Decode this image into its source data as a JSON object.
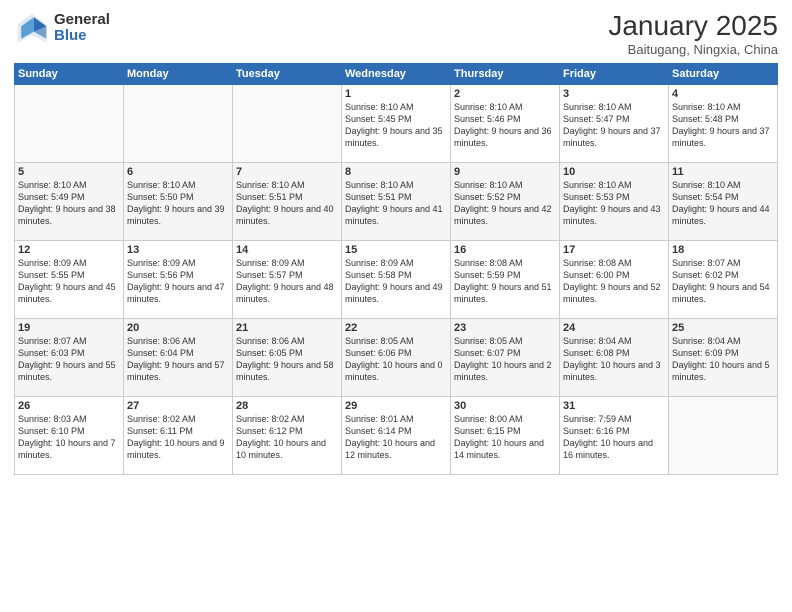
{
  "logo": {
    "general": "General",
    "blue": "Blue"
  },
  "header": {
    "month": "January 2025",
    "location": "Baitugang, Ningxia, China"
  },
  "weekdays": [
    "Sunday",
    "Monday",
    "Tuesday",
    "Wednesday",
    "Thursday",
    "Friday",
    "Saturday"
  ],
  "weeks": [
    [
      {
        "day": "",
        "text": ""
      },
      {
        "day": "",
        "text": ""
      },
      {
        "day": "",
        "text": ""
      },
      {
        "day": "1",
        "text": "Sunrise: 8:10 AM\nSunset: 5:45 PM\nDaylight: 9 hours and 35 minutes."
      },
      {
        "day": "2",
        "text": "Sunrise: 8:10 AM\nSunset: 5:46 PM\nDaylight: 9 hours and 36 minutes."
      },
      {
        "day": "3",
        "text": "Sunrise: 8:10 AM\nSunset: 5:47 PM\nDaylight: 9 hours and 37 minutes."
      },
      {
        "day": "4",
        "text": "Sunrise: 8:10 AM\nSunset: 5:48 PM\nDaylight: 9 hours and 37 minutes."
      }
    ],
    [
      {
        "day": "5",
        "text": "Sunrise: 8:10 AM\nSunset: 5:49 PM\nDaylight: 9 hours and 38 minutes."
      },
      {
        "day": "6",
        "text": "Sunrise: 8:10 AM\nSunset: 5:50 PM\nDaylight: 9 hours and 39 minutes."
      },
      {
        "day": "7",
        "text": "Sunrise: 8:10 AM\nSunset: 5:51 PM\nDaylight: 9 hours and 40 minutes."
      },
      {
        "day": "8",
        "text": "Sunrise: 8:10 AM\nSunset: 5:51 PM\nDaylight: 9 hours and 41 minutes."
      },
      {
        "day": "9",
        "text": "Sunrise: 8:10 AM\nSunset: 5:52 PM\nDaylight: 9 hours and 42 minutes."
      },
      {
        "day": "10",
        "text": "Sunrise: 8:10 AM\nSunset: 5:53 PM\nDaylight: 9 hours and 43 minutes."
      },
      {
        "day": "11",
        "text": "Sunrise: 8:10 AM\nSunset: 5:54 PM\nDaylight: 9 hours and 44 minutes."
      }
    ],
    [
      {
        "day": "12",
        "text": "Sunrise: 8:09 AM\nSunset: 5:55 PM\nDaylight: 9 hours and 45 minutes."
      },
      {
        "day": "13",
        "text": "Sunrise: 8:09 AM\nSunset: 5:56 PM\nDaylight: 9 hours and 47 minutes."
      },
      {
        "day": "14",
        "text": "Sunrise: 8:09 AM\nSunset: 5:57 PM\nDaylight: 9 hours and 48 minutes."
      },
      {
        "day": "15",
        "text": "Sunrise: 8:09 AM\nSunset: 5:58 PM\nDaylight: 9 hours and 49 minutes."
      },
      {
        "day": "16",
        "text": "Sunrise: 8:08 AM\nSunset: 5:59 PM\nDaylight: 9 hours and 51 minutes."
      },
      {
        "day": "17",
        "text": "Sunrise: 8:08 AM\nSunset: 6:00 PM\nDaylight: 9 hours and 52 minutes."
      },
      {
        "day": "18",
        "text": "Sunrise: 8:07 AM\nSunset: 6:02 PM\nDaylight: 9 hours and 54 minutes."
      }
    ],
    [
      {
        "day": "19",
        "text": "Sunrise: 8:07 AM\nSunset: 6:03 PM\nDaylight: 9 hours and 55 minutes."
      },
      {
        "day": "20",
        "text": "Sunrise: 8:06 AM\nSunset: 6:04 PM\nDaylight: 9 hours and 57 minutes."
      },
      {
        "day": "21",
        "text": "Sunrise: 8:06 AM\nSunset: 6:05 PM\nDaylight: 9 hours and 58 minutes."
      },
      {
        "day": "22",
        "text": "Sunrise: 8:05 AM\nSunset: 6:06 PM\nDaylight: 10 hours and 0 minutes."
      },
      {
        "day": "23",
        "text": "Sunrise: 8:05 AM\nSunset: 6:07 PM\nDaylight: 10 hours and 2 minutes."
      },
      {
        "day": "24",
        "text": "Sunrise: 8:04 AM\nSunset: 6:08 PM\nDaylight: 10 hours and 3 minutes."
      },
      {
        "day": "25",
        "text": "Sunrise: 8:04 AM\nSunset: 6:09 PM\nDaylight: 10 hours and 5 minutes."
      }
    ],
    [
      {
        "day": "26",
        "text": "Sunrise: 8:03 AM\nSunset: 6:10 PM\nDaylight: 10 hours and 7 minutes."
      },
      {
        "day": "27",
        "text": "Sunrise: 8:02 AM\nSunset: 6:11 PM\nDaylight: 10 hours and 9 minutes."
      },
      {
        "day": "28",
        "text": "Sunrise: 8:02 AM\nSunset: 6:12 PM\nDaylight: 10 hours and 10 minutes."
      },
      {
        "day": "29",
        "text": "Sunrise: 8:01 AM\nSunset: 6:14 PM\nDaylight: 10 hours and 12 minutes."
      },
      {
        "day": "30",
        "text": "Sunrise: 8:00 AM\nSunset: 6:15 PM\nDaylight: 10 hours and 14 minutes."
      },
      {
        "day": "31",
        "text": "Sunrise: 7:59 AM\nSunset: 6:16 PM\nDaylight: 10 hours and 16 minutes."
      },
      {
        "day": "",
        "text": ""
      }
    ]
  ]
}
